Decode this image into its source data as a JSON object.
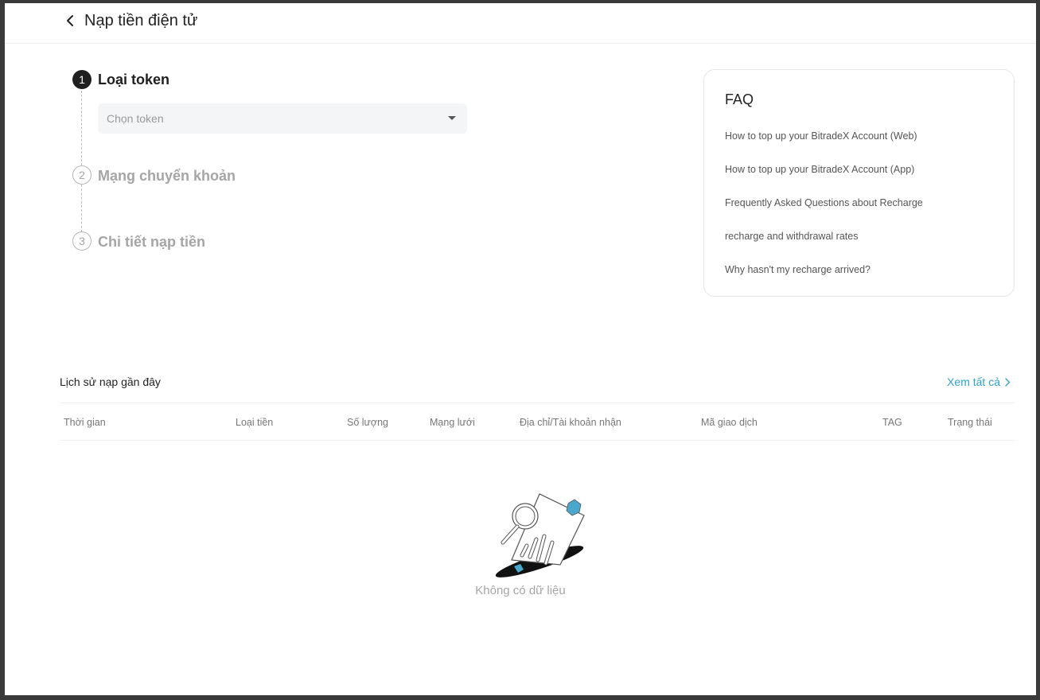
{
  "header": {
    "title": "Nạp tiền điện tử"
  },
  "steps": [
    {
      "number": "1",
      "title": "Loại token"
    },
    {
      "number": "2",
      "title": "Mạng chuyển khoản"
    },
    {
      "number": "3",
      "title": "Chi tiết nạp tiền"
    }
  ],
  "token_select": {
    "placeholder": "Chọn token"
  },
  "faq": {
    "title": "FAQ",
    "links": [
      "How to top up your BitradeX Account (Web)",
      "How to top up your BitradeX Account (App)",
      "Frequently Asked Questions about Recharge",
      "recharge and withdrawal rates",
      "Why hasn't my recharge arrived?"
    ]
  },
  "history": {
    "title": "Lịch sử nạp gần đây",
    "view_all": "Xem tất cả",
    "columns": [
      "Thời gian",
      "Loại tiền",
      "Số lượng",
      "Mạng lưới",
      "Địa chỉ/Tài khoản nhận",
      "Mã giao dịch",
      "TAG",
      "Trạng thái"
    ],
    "empty_text": "Không có dữ liệu"
  },
  "colors": {
    "accent": "#2fa2c9",
    "active_step": "#1f1f1f",
    "inactive": "#a5a5a5"
  },
  "icons": {
    "back": "chevron-left-icon",
    "select_caret": "caret-down-icon",
    "view_all": "chevron-right-icon",
    "empty": "empty-document-illustration"
  }
}
